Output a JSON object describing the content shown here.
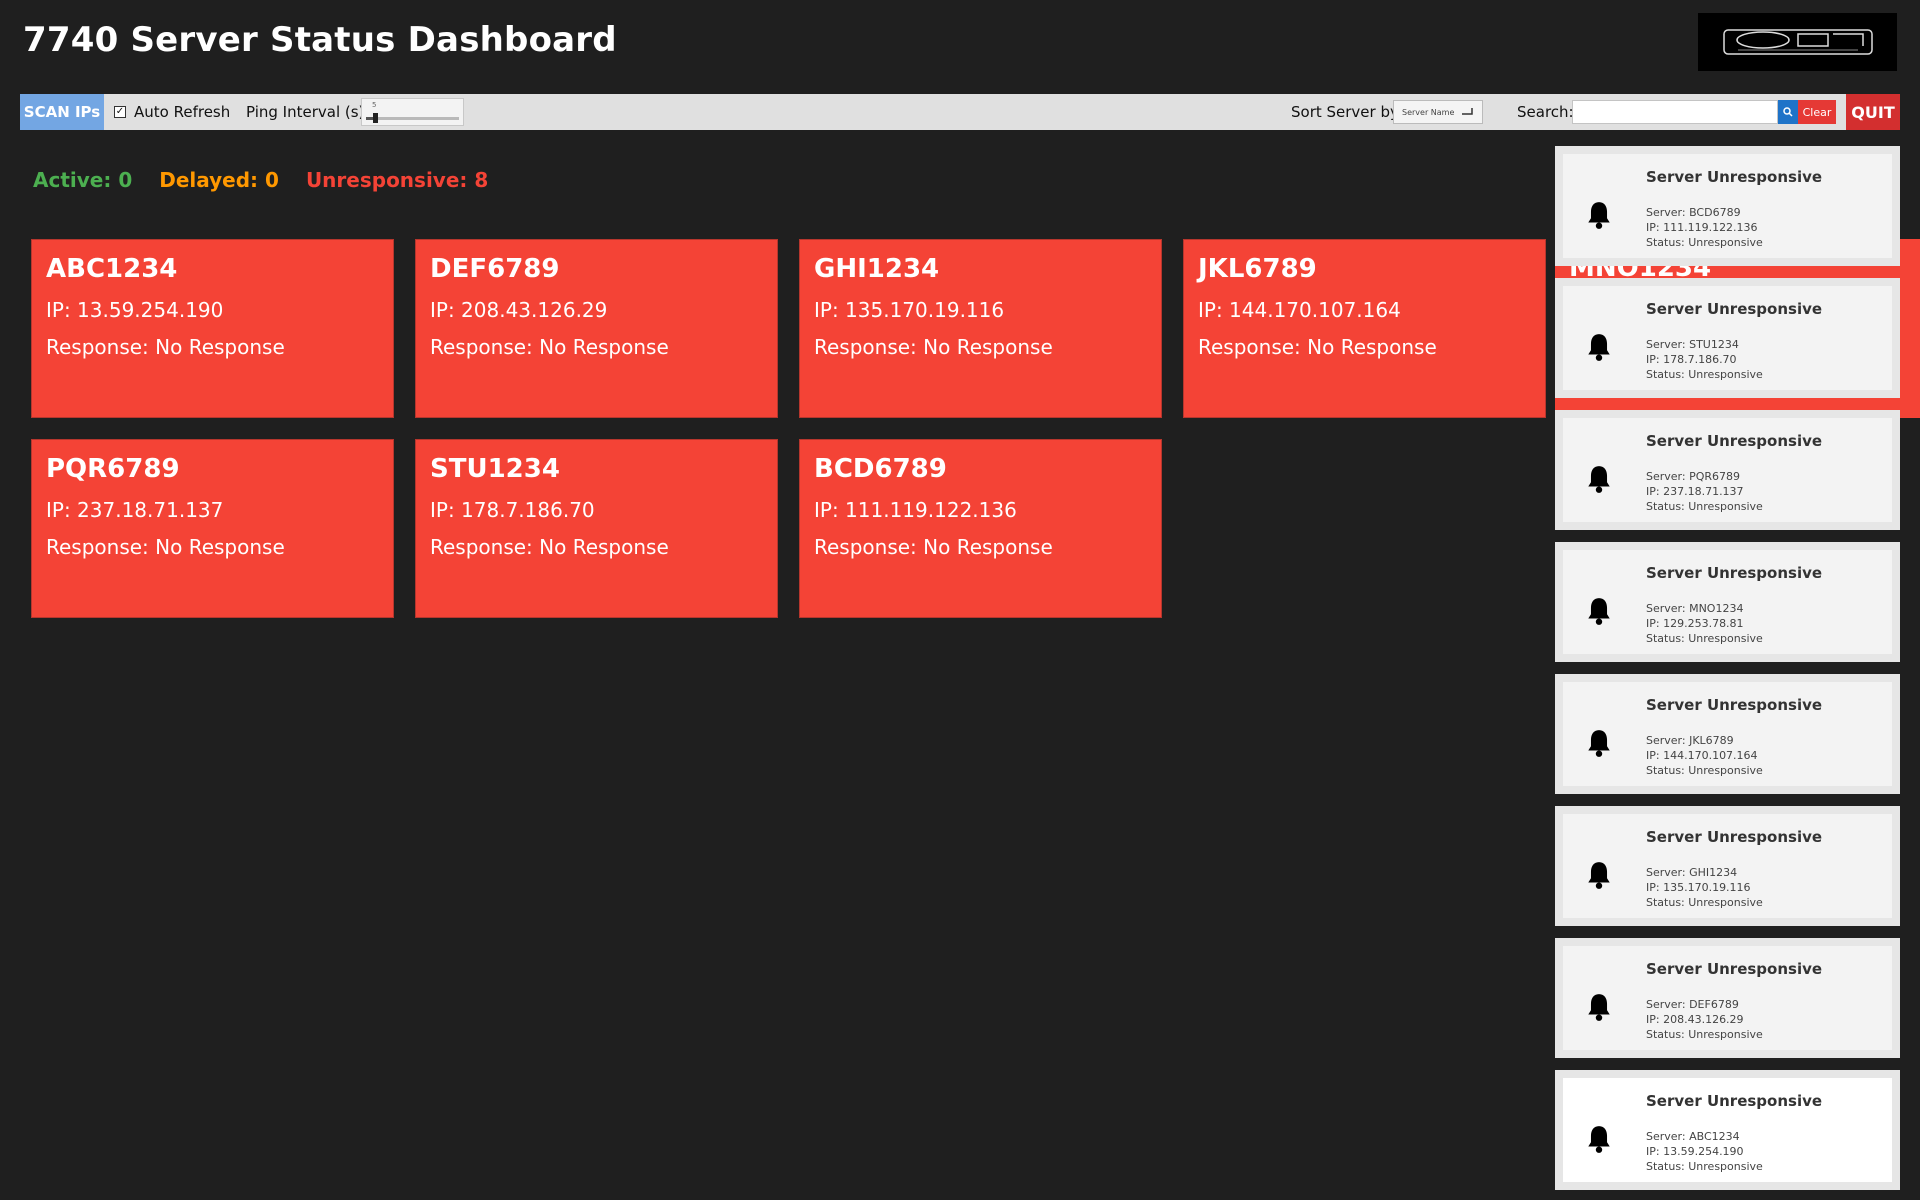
{
  "app": {
    "title": "7740 Server Status Dashboard",
    "logo_name": "company-logo"
  },
  "toolbar": {
    "scan_label": "SCAN IPs",
    "auto_refresh_label": "Auto Refresh",
    "auto_refresh_checked": true,
    "ping_label": "Ping Interval (s):",
    "ping_value": "5",
    "ping_fraction": 0.08,
    "sort_label": "Sort Server by:",
    "sort_value": "Server Name",
    "search_label": "Search:",
    "search_value": "",
    "clear_label": "Clear",
    "quit_label": "QUIT"
  },
  "summary": {
    "active": "Active: 0",
    "delayed": "Delayed: 0",
    "unresponsive": "Unresponsive: 8",
    "colors": {
      "active": "#4caf50",
      "delayed": "#ff9800",
      "unresponsive": "#f44336"
    }
  },
  "servers": [
    {
      "name": "ABC1234",
      "ip": "IP: 13.59.254.190",
      "response": "Response: No Response"
    },
    {
      "name": "DEF6789",
      "ip": "IP: 208.43.126.29",
      "response": "Response: No Response"
    },
    {
      "name": "GHI1234",
      "ip": "IP: 135.170.19.116",
      "response": "Response: No Response"
    },
    {
      "name": "JKL6789",
      "ip": "IP: 144.170.107.164",
      "response": "Response: No Response"
    },
    {
      "name": "PQR6789",
      "ip": "IP: 237.18.71.137",
      "response": "Response: No Response"
    },
    {
      "name": "STU1234",
      "ip": "IP: 178.7.186.70",
      "response": "Response: No Response"
    },
    {
      "name": "BCD6789",
      "ip": "IP: 111.119.122.136",
      "response": "Response: No Response"
    }
  ],
  "hidden_card": {
    "name": "MNO1234"
  },
  "notifications": [
    {
      "title": "Server Unresponsive",
      "server": "Server: BCD6789",
      "ip": "IP: 111.119.122.136",
      "status": "Status: Unresponsive"
    },
    {
      "title": "Server Unresponsive",
      "server": "Server: STU1234",
      "ip": "IP: 178.7.186.70",
      "status": "Status: Unresponsive"
    },
    {
      "title": "Server Unresponsive",
      "server": "Server: PQR6789",
      "ip": "IP: 237.18.71.137",
      "status": "Status: Unresponsive"
    },
    {
      "title": "Server Unresponsive",
      "server": "Server: MNO1234",
      "ip": "IP: 129.253.78.81",
      "status": "Status: Unresponsive"
    },
    {
      "title": "Server Unresponsive",
      "server": "Server: JKL6789",
      "ip": "IP: 144.170.107.164",
      "status": "Status: Unresponsive"
    },
    {
      "title": "Server Unresponsive",
      "server": "Server: GHI1234",
      "ip": "IP: 135.170.19.116",
      "status": "Status: Unresponsive"
    },
    {
      "title": "Server Unresponsive",
      "server": "Server: DEF6789",
      "ip": "IP: 208.43.126.29",
      "status": "Status: Unresponsive"
    },
    {
      "title": "Server Unresponsive",
      "server": "Server: ABC1234",
      "ip": "IP: 13.59.254.190",
      "status": "Status: Unresponsive"
    }
  ],
  "icons": {
    "notification": "bell-icon",
    "search": "search-icon",
    "checkbox": "check-icon",
    "dropdown": "dropdown-icon"
  }
}
